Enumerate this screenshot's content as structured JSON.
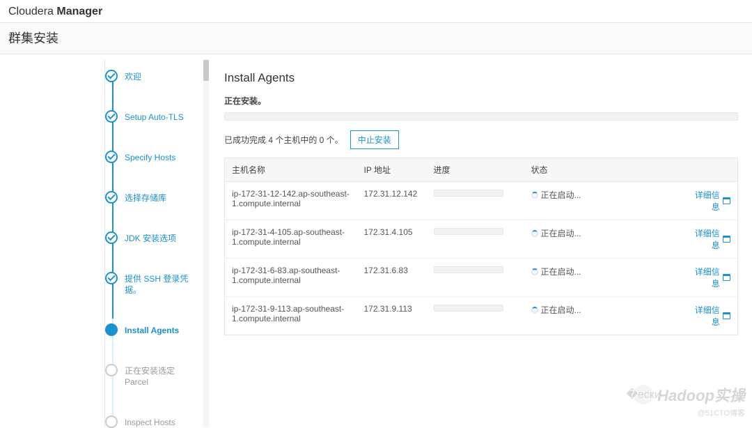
{
  "brand": {
    "light": "Cloudera ",
    "bold": "Manager"
  },
  "subtitle": "群集安装",
  "sidebar": {
    "steps": [
      {
        "label": "欢迎",
        "state": "done"
      },
      {
        "label": "Setup Auto-TLS",
        "state": "done"
      },
      {
        "label": "Specify Hosts",
        "state": "done"
      },
      {
        "label": "选择存储库",
        "state": "done"
      },
      {
        "label": "JDK 安装选项",
        "state": "done"
      },
      {
        "label": "提供 SSH 登录凭据。",
        "state": "done"
      },
      {
        "label": "Install Agents",
        "state": "current"
      },
      {
        "label": "正在安装选定 Parcel",
        "state": "future"
      },
      {
        "label": "Inspect Hosts",
        "state": "future"
      }
    ]
  },
  "main": {
    "title": "Install Agents",
    "installing_label": "正在安装。",
    "summary_text": "已成功完成 4 个主机中的 0 个。",
    "abort_button": "中止安装",
    "table": {
      "headers": {
        "host": "主机名称",
        "ip": "IP 地址",
        "progress": "进度",
        "status": "状态"
      },
      "detail_label": "详细信息",
      "status_text": "正在启动...",
      "rows": [
        {
          "host": "ip-172-31-12-142.ap-southeast-1.compute.internal",
          "ip": "172.31.12.142"
        },
        {
          "host": "ip-172-31-4-105.ap-southeast-1.compute.internal",
          "ip": "172.31.4.105"
        },
        {
          "host": "ip-172-31-6-83.ap-southeast-1.compute.internal",
          "ip": "172.31.6.83"
        },
        {
          "host": "ip-172-31-9-113.ap-southeast-1.compute.internal",
          "ip": "172.31.9.113"
        }
      ]
    }
  },
  "watermark": {
    "top": "Hadoop实操",
    "bottom": "@51CTO博客"
  }
}
